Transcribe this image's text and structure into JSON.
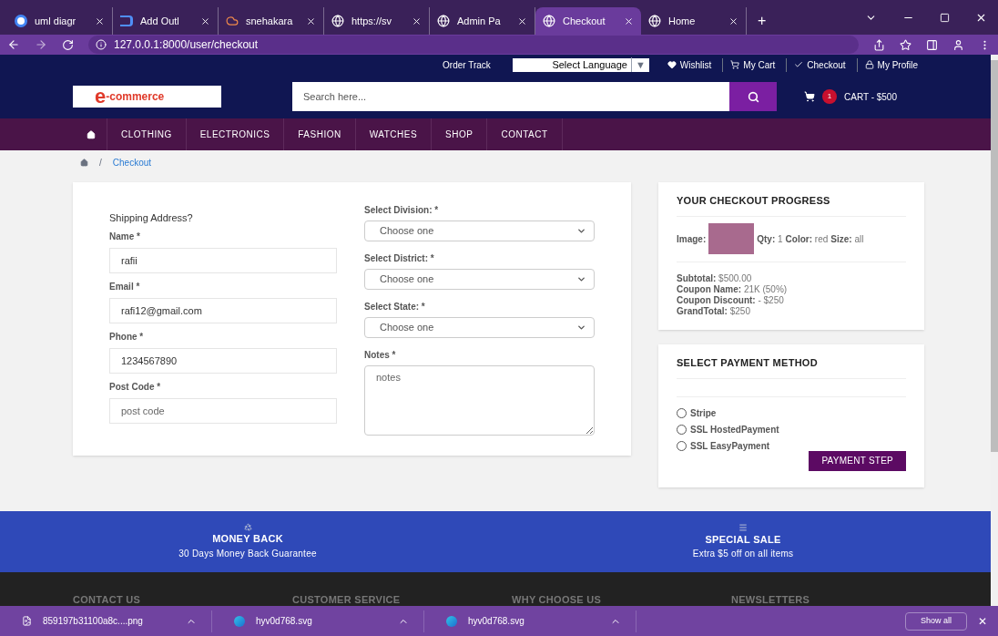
{
  "browser": {
    "tabs": [
      {
        "title": "uml diagr",
        "selected": false,
        "kind": "google"
      },
      {
        "title": "Add Outl",
        "selected": false,
        "kind": "outline"
      },
      {
        "title": "snehakara",
        "selected": false,
        "kind": "cloud"
      },
      {
        "title": "https://sv",
        "selected": false,
        "kind": "globe"
      },
      {
        "title": "Admin Pa",
        "selected": false,
        "kind": "globe"
      },
      {
        "title": "Checkout",
        "selected": true,
        "kind": "globe"
      },
      {
        "title": "Home",
        "selected": false,
        "kind": "globe"
      }
    ],
    "new_tab": "+",
    "url": "127.0.0.1:8000/user/checkout"
  },
  "top_bar": {
    "order_track": "Order Track",
    "language": "Select Language",
    "language_caret": "▼",
    "links": [
      {
        "label": "Wishlist",
        "kind": "heart"
      },
      {
        "label": "My Cart",
        "kind": "cart"
      },
      {
        "label": "Checkout",
        "kind": "check"
      },
      {
        "label": "My Profile",
        "kind": "lock"
      }
    ]
  },
  "header": {
    "logo_letter": "e",
    "logo_text": "-commerce",
    "search": {
      "placeholder": "Search here..."
    },
    "cart_count": "1",
    "cart_label": "CART - $500"
  },
  "nav": {
    "items": [
      "CLOTHING",
      "ELECTRONICS",
      "FASHION",
      "WATCHES",
      "SHOP",
      "CONTACT"
    ]
  },
  "breadcrumb": {
    "separator": "/",
    "current": "Checkout"
  },
  "shipping": {
    "title": "Shipping Address?",
    "fields": [
      {
        "label": "Name *",
        "value": "rafii"
      },
      {
        "label": "Email *",
        "value": "rafi12@gmail.com"
      },
      {
        "label": "Phone *",
        "value": "1234567890"
      },
      {
        "label": "Post Code *",
        "placeholder": "post code"
      }
    ],
    "selects": [
      {
        "label": "Select Division: *",
        "value": "Choose one"
      },
      {
        "label": "Select District: *",
        "value": "Choose one"
      },
      {
        "label": "Select State: *",
        "value": "Choose one"
      }
    ],
    "notes": {
      "label": "Notes *",
      "placeholder": "notes"
    }
  },
  "progress": {
    "title": "YOUR CHECKOUT PROGRESS",
    "image_label": "Image:",
    "item": [
      {
        "label": "Qty:",
        "value": "1"
      },
      {
        "label": "Color:",
        "value": "red"
      },
      {
        "label": "Size:",
        "value": "all"
      }
    ],
    "totals": [
      {
        "label": "Subtotal:",
        "value": "$500.00"
      },
      {
        "label": "Coupon Name:",
        "value": "21K (50%)"
      },
      {
        "label": "Coupon Discount:",
        "value": "- $250"
      },
      {
        "label": "GrandTotal:",
        "value": "$250"
      }
    ]
  },
  "payment": {
    "title": "SELECT PAYMENT METHOD",
    "options": [
      {
        "label": "Stripe",
        "selected": false
      },
      {
        "label": "SSL HostedPayment",
        "selected": false
      },
      {
        "label": "SSL EasyPayment",
        "selected": false
      }
    ],
    "button": "PAYMENT STEP"
  },
  "features": [
    {
      "title": "MONEY BACK",
      "text": "30 Days Money Back Guarantee",
      "kind": "recycle"
    },
    {
      "title": "SPECIAL SALE",
      "text": "Extra $5 off on all items",
      "kind": "bars"
    }
  ],
  "footer_headings": [
    "CONTACT US",
    "CUSTOMER SERVICE",
    "WHY CHOOSE US",
    "NEWSLETTERS"
  ],
  "downloads": {
    "items": [
      {
        "name": "859197b31100a8c....png",
        "kind": "file"
      },
      {
        "name": "hyv0d768.svg",
        "kind": "edge"
      },
      {
        "name": "hyv0d768.svg",
        "kind": "edge"
      }
    ],
    "show_all": "Show all",
    "close": "✕"
  }
}
